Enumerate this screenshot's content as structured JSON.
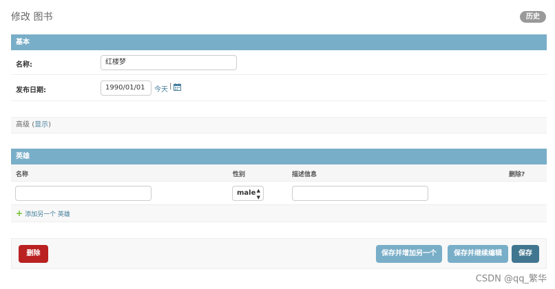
{
  "page": {
    "title": "修改 图书"
  },
  "header": {
    "history_label": "历史"
  },
  "basic": {
    "section_title": "基本",
    "name_label": "名称:",
    "name_value": "红楼梦",
    "date_label": "发布日期:",
    "date_value": "1990/01/01",
    "today_label": "今天",
    "separator": "|",
    "calendar_icon": "calendar-icon"
  },
  "advanced": {
    "label": "高级",
    "open_paren": "(",
    "toggle_label": "显示",
    "close_paren": ")"
  },
  "heroes": {
    "section_title": "英雄",
    "columns": {
      "name": "名称",
      "gender": "性别",
      "description": "描述信息",
      "delete": "删除?"
    },
    "row": {
      "name_value": "",
      "gender_value": "male",
      "description_value": ""
    },
    "add_label": "添加另一个 英雄"
  },
  "actions": {
    "delete_label": "删除",
    "save_add_another_label": "保存并增加另一个",
    "save_continue_label": "保存并继续编辑",
    "save_label": "保存"
  },
  "watermark": "CSDN @qq_繁华",
  "colors": {
    "module_header": "#79aec8",
    "primary": "#417690",
    "delete": "#ba2121",
    "link": "#447e9b"
  }
}
